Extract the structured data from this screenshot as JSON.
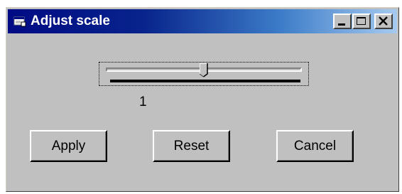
{
  "window": {
    "title": "Adjust scale",
    "title_icon": "window-app-icon",
    "caption_buttons": [
      "minimize-icon",
      "maximize-icon",
      "close-icon"
    ]
  },
  "slider": {
    "value_label": "1",
    "position_fraction": 0.5
  },
  "buttons": {
    "apply": "Apply",
    "reset": "Reset",
    "cancel": "Cancel"
  },
  "colors": {
    "titlebar_start": "#000a84",
    "titlebar_end": "#a6caf0",
    "face": "#c0c0c0"
  }
}
